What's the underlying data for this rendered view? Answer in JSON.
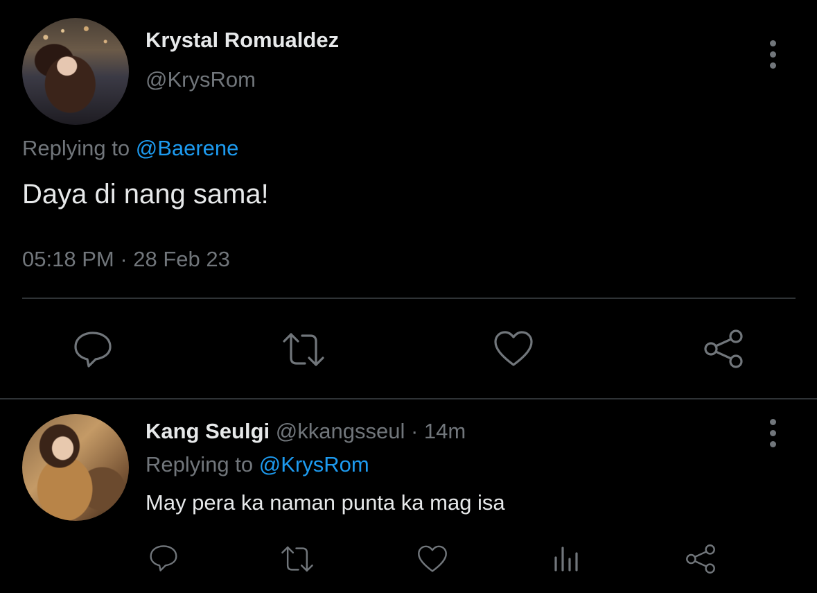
{
  "tweet": {
    "author_name": "Krystal Romualdez",
    "author_handle": "@KrysRom",
    "replying_label": "Replying to",
    "replying_to": "@Baerene",
    "text": "Daya di nang sama!",
    "time": "05:18 PM",
    "separator": " · ",
    "date": "28 Feb 23"
  },
  "reply": {
    "author_name": "Kang Seulgi",
    "author_handle": "@kkangsseul",
    "age": "· 14m",
    "replying_label": "Replying to",
    "replying_to": "@KrysRom",
    "text": "May pera ka naman punta ka mag isa"
  },
  "icons": {
    "reply": "reply-icon",
    "retweet": "retweet-icon",
    "like": "heart-icon",
    "share": "share-icon",
    "views": "analytics-icon",
    "more": "more-vertical-icon"
  },
  "colors": {
    "background": "#000000",
    "text": "#e7e9ea",
    "muted": "#71767b",
    "accent": "#1d9bf0",
    "divider": "#2f3336"
  }
}
